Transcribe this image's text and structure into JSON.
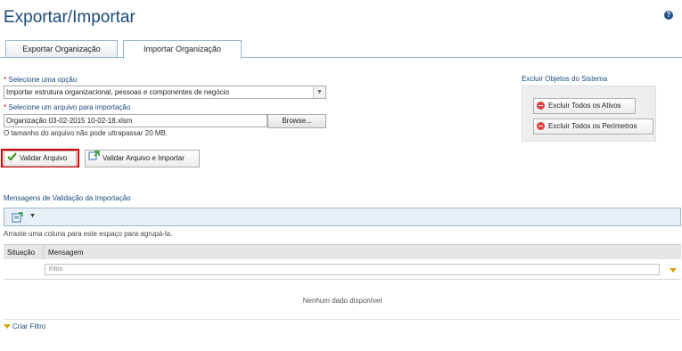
{
  "page": {
    "title": "Exportar/Importar",
    "help_icon": "question-circle-icon"
  },
  "tabs": [
    {
      "label": "Exportar Organização",
      "active": false
    },
    {
      "label": "Importar Organização",
      "active": true
    }
  ],
  "form": {
    "option_label": "Selecione uma opção",
    "option_value": "Importar estrutura organizacional, pessoas e componentes de negócio",
    "file_label": "Selecione um arquivo para importação",
    "file_value": "Organização 03-02-2015 10-02-18.xlsm",
    "browse_label": "Browse...",
    "size_note": "O tamanho do arquivo não pode ultrapassar 20 MB.",
    "required_mark": "*"
  },
  "actions": {
    "validate_label": "Validar Arquivo",
    "validate_import_label": "Validar Arquivo e Importar"
  },
  "system_objects": {
    "title": "Excluir Objetos do Sistema",
    "delete_assets_label": "Excluir Todos os Ativos",
    "delete_perimeters_label": "Excluir Todos os Perímetros"
  },
  "grid": {
    "title": "Mensagens de Validação da Importação",
    "group_hint": "Arraste uma coluna para este espaço para agrupá-la.",
    "columns": [
      "Situação",
      "Mensagem"
    ],
    "filter_placeholder": "Filtro",
    "empty_text": "Nenhum dado disponível",
    "create_filter_label": "Criar Filtro"
  },
  "colors": {
    "title": "#1a4a7a",
    "highlight": "#e00000",
    "delete_icon": "#e04040"
  }
}
